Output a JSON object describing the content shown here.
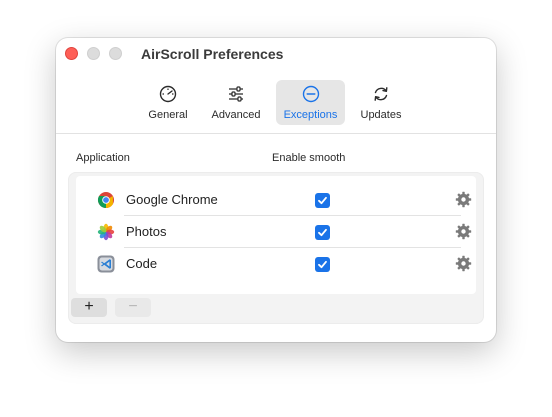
{
  "window": {
    "title": "AirScroll Preferences"
  },
  "toolbar": {
    "tabs": [
      {
        "label": "General",
        "icon": "speedometer-icon"
      },
      {
        "label": "Advanced",
        "icon": "sliders-icon"
      },
      {
        "label": "Exceptions",
        "icon": "minus-circle-icon",
        "selected": true
      },
      {
        "label": "Updates",
        "icon": "refresh-icon"
      }
    ]
  },
  "columns": {
    "application": "Application",
    "enable_smooth": "Enable smooth"
  },
  "apps": [
    {
      "name": "Google Chrome",
      "icon": "chrome-icon",
      "enabled": true
    },
    {
      "name": "Photos",
      "icon": "photos-icon",
      "enabled": true
    },
    {
      "name": "Code",
      "icon": "vscode-icon",
      "enabled": true
    }
  ],
  "buttons": {
    "add": "+",
    "remove": "−"
  },
  "colors": {
    "accent": "#1a73e8",
    "close": "#fe5f57"
  }
}
